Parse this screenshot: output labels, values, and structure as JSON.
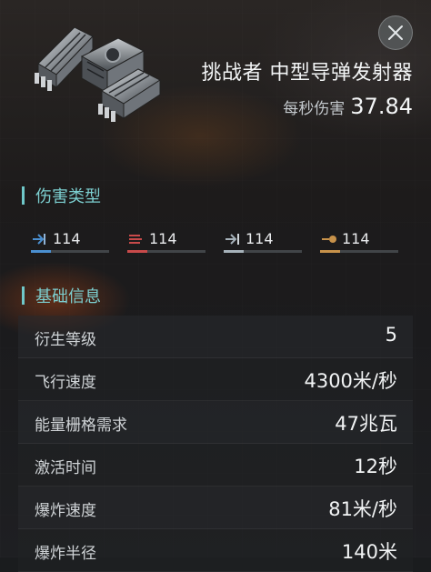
{
  "item": {
    "name": "挑战者 中型导弹发射器",
    "dps_label": "每秒伤害",
    "dps_value": "37.84"
  },
  "sections": {
    "damage_type": "伤害类型",
    "basic_info": "基础信息"
  },
  "damage_types": [
    {
      "icon": "em-damage-icon",
      "value": "114",
      "color": "#4a8fd0"
    },
    {
      "icon": "thermal-damage-icon",
      "value": "114",
      "color": "#c84a4a"
    },
    {
      "icon": "kinetic-damage-icon",
      "value": "114",
      "color": "#a6b2ba"
    },
    {
      "icon": "explosive-damage-icon",
      "value": "114",
      "color": "#c7924a"
    }
  ],
  "stats": [
    {
      "label": "衍生等级",
      "value": "5"
    },
    {
      "label": "飞行速度",
      "value": "4300米/秒"
    },
    {
      "label": "能量栅格需求",
      "value": "47兆瓦"
    },
    {
      "label": "激活时间",
      "value": "12秒"
    },
    {
      "label": "爆炸速度",
      "value": "81米/秒"
    },
    {
      "label": "爆炸半径",
      "value": "140米"
    }
  ]
}
